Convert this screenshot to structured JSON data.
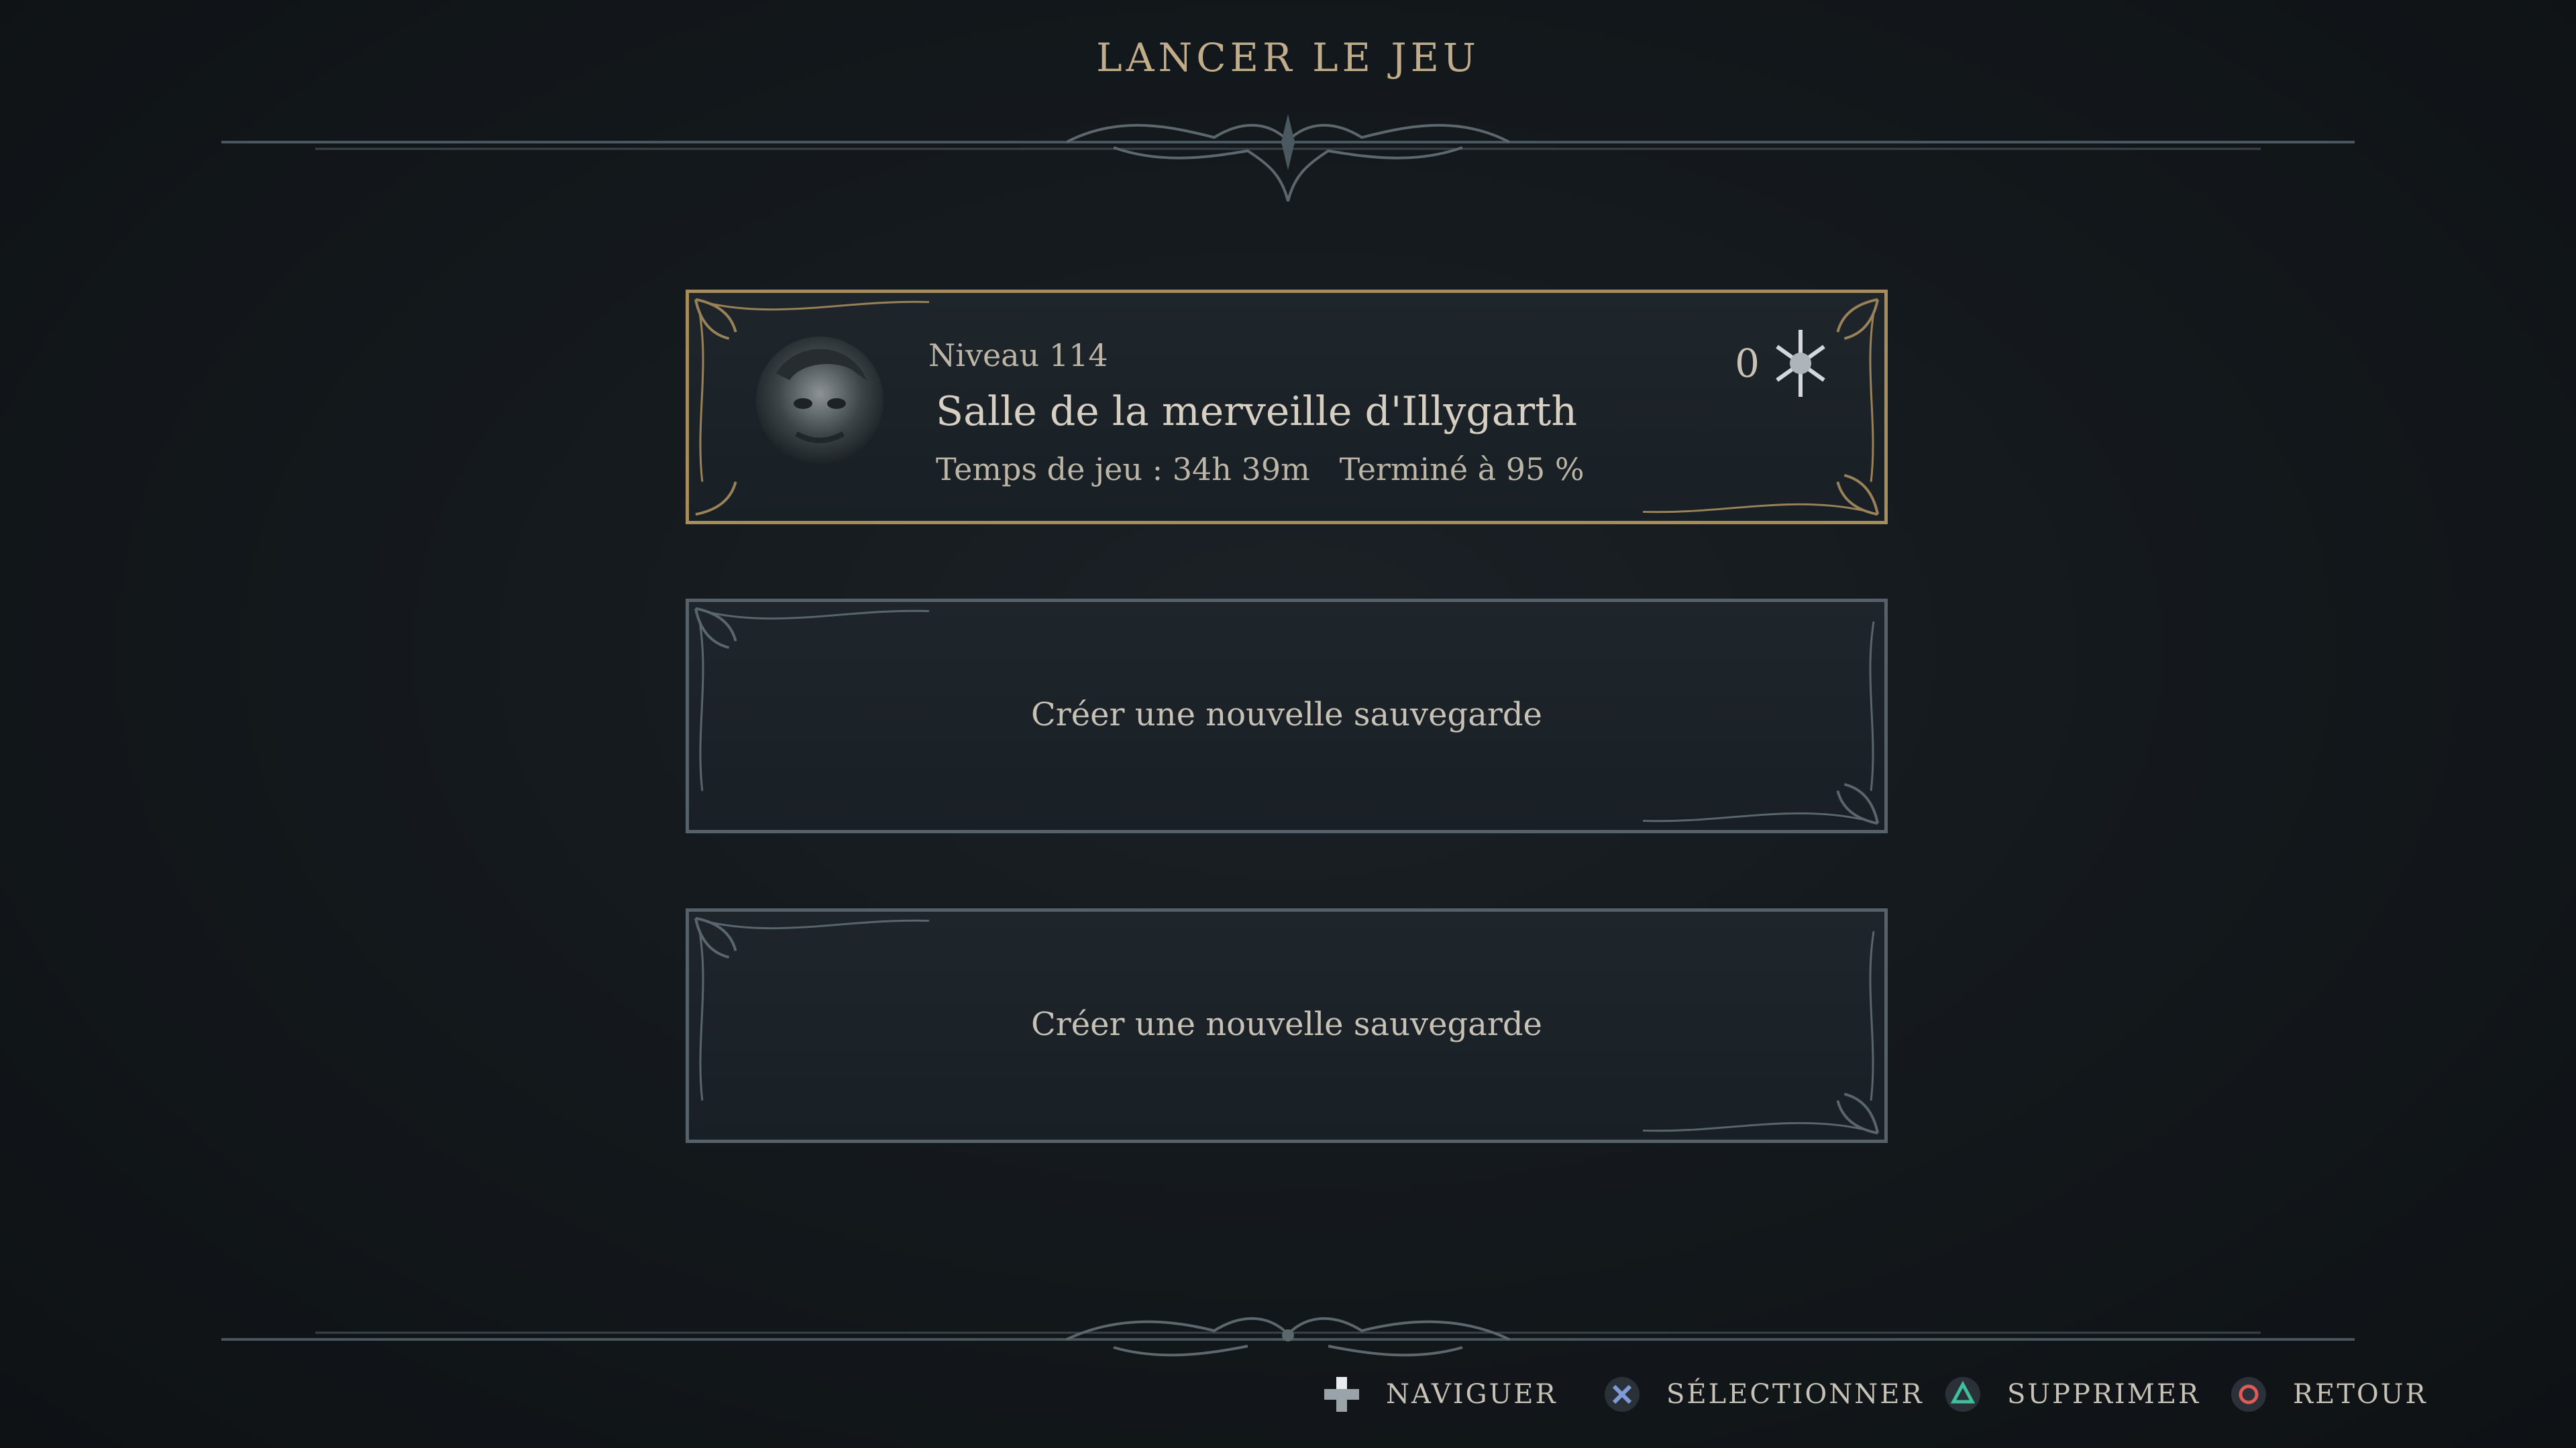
{
  "screen": {
    "title": "LANCER LE JEU"
  },
  "save_slots": [
    {
      "state": "occupied",
      "selected": true,
      "level": "Niveau 114",
      "location": "Salle de la merveille d'Illygarth",
      "playtime": "Temps de jeu : 34h 39m",
      "completion": "Terminé à 95 %",
      "currency_count": "0",
      "currency_icon": "star-sigil-icon",
      "portrait_icon": "character-portrait"
    },
    {
      "state": "empty",
      "label": "Créer une nouvelle sauvegarde"
    },
    {
      "state": "empty",
      "label": "Créer une nouvelle sauvegarde"
    }
  ],
  "footer_hints": [
    {
      "icon": "dpad-icon",
      "label": "NAVIGUER"
    },
    {
      "icon": "cross-button-icon",
      "label": "SÉLECTIONNER"
    },
    {
      "icon": "triangle-button-icon",
      "label": "SUPPRIMER"
    },
    {
      "icon": "circle-button-icon",
      "label": "RETOUR"
    }
  ],
  "colors": {
    "accent_gold": "#a88c5c",
    "slot_border": "#56626b",
    "cross": "#7f9bd6",
    "triangle": "#3fbf9a",
    "circle": "#e05a5a"
  }
}
